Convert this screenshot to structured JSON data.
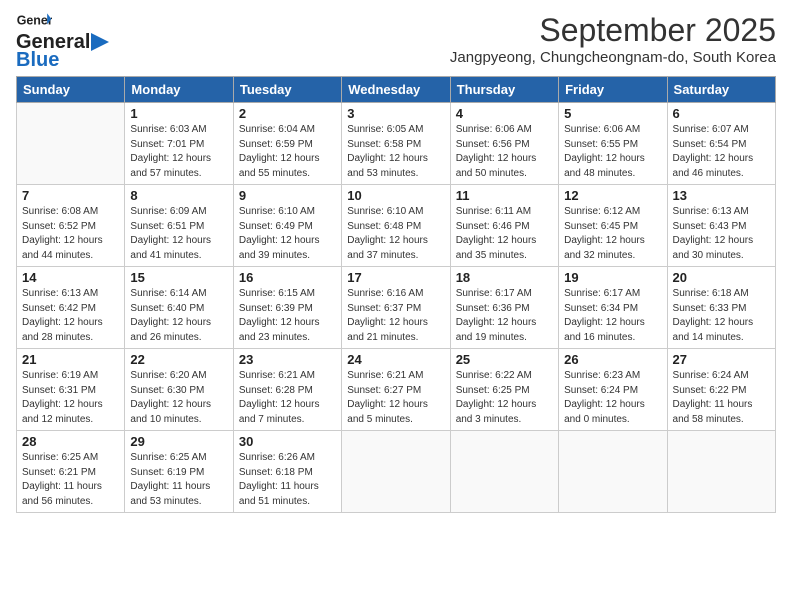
{
  "header": {
    "logo_line1": "General",
    "logo_line2": "Blue",
    "month_title": "September 2025",
    "location": "Jangpyeong, Chungcheongnam-do, South Korea"
  },
  "weekdays": [
    "Sunday",
    "Monday",
    "Tuesday",
    "Wednesday",
    "Thursday",
    "Friday",
    "Saturday"
  ],
  "weeks": [
    [
      {
        "day": "",
        "detail": ""
      },
      {
        "day": "1",
        "detail": "Sunrise: 6:03 AM\nSunset: 7:01 PM\nDaylight: 12 hours\nand 57 minutes."
      },
      {
        "day": "2",
        "detail": "Sunrise: 6:04 AM\nSunset: 6:59 PM\nDaylight: 12 hours\nand 55 minutes."
      },
      {
        "day": "3",
        "detail": "Sunrise: 6:05 AM\nSunset: 6:58 PM\nDaylight: 12 hours\nand 53 minutes."
      },
      {
        "day": "4",
        "detail": "Sunrise: 6:06 AM\nSunset: 6:56 PM\nDaylight: 12 hours\nand 50 minutes."
      },
      {
        "day": "5",
        "detail": "Sunrise: 6:06 AM\nSunset: 6:55 PM\nDaylight: 12 hours\nand 48 minutes."
      },
      {
        "day": "6",
        "detail": "Sunrise: 6:07 AM\nSunset: 6:54 PM\nDaylight: 12 hours\nand 46 minutes."
      }
    ],
    [
      {
        "day": "7",
        "detail": "Sunrise: 6:08 AM\nSunset: 6:52 PM\nDaylight: 12 hours\nand 44 minutes."
      },
      {
        "day": "8",
        "detail": "Sunrise: 6:09 AM\nSunset: 6:51 PM\nDaylight: 12 hours\nand 41 minutes."
      },
      {
        "day": "9",
        "detail": "Sunrise: 6:10 AM\nSunset: 6:49 PM\nDaylight: 12 hours\nand 39 minutes."
      },
      {
        "day": "10",
        "detail": "Sunrise: 6:10 AM\nSunset: 6:48 PM\nDaylight: 12 hours\nand 37 minutes."
      },
      {
        "day": "11",
        "detail": "Sunrise: 6:11 AM\nSunset: 6:46 PM\nDaylight: 12 hours\nand 35 minutes."
      },
      {
        "day": "12",
        "detail": "Sunrise: 6:12 AM\nSunset: 6:45 PM\nDaylight: 12 hours\nand 32 minutes."
      },
      {
        "day": "13",
        "detail": "Sunrise: 6:13 AM\nSunset: 6:43 PM\nDaylight: 12 hours\nand 30 minutes."
      }
    ],
    [
      {
        "day": "14",
        "detail": "Sunrise: 6:13 AM\nSunset: 6:42 PM\nDaylight: 12 hours\nand 28 minutes."
      },
      {
        "day": "15",
        "detail": "Sunrise: 6:14 AM\nSunset: 6:40 PM\nDaylight: 12 hours\nand 26 minutes."
      },
      {
        "day": "16",
        "detail": "Sunrise: 6:15 AM\nSunset: 6:39 PM\nDaylight: 12 hours\nand 23 minutes."
      },
      {
        "day": "17",
        "detail": "Sunrise: 6:16 AM\nSunset: 6:37 PM\nDaylight: 12 hours\nand 21 minutes."
      },
      {
        "day": "18",
        "detail": "Sunrise: 6:17 AM\nSunset: 6:36 PM\nDaylight: 12 hours\nand 19 minutes."
      },
      {
        "day": "19",
        "detail": "Sunrise: 6:17 AM\nSunset: 6:34 PM\nDaylight: 12 hours\nand 16 minutes."
      },
      {
        "day": "20",
        "detail": "Sunrise: 6:18 AM\nSunset: 6:33 PM\nDaylight: 12 hours\nand 14 minutes."
      }
    ],
    [
      {
        "day": "21",
        "detail": "Sunrise: 6:19 AM\nSunset: 6:31 PM\nDaylight: 12 hours\nand 12 minutes."
      },
      {
        "day": "22",
        "detail": "Sunrise: 6:20 AM\nSunset: 6:30 PM\nDaylight: 12 hours\nand 10 minutes."
      },
      {
        "day": "23",
        "detail": "Sunrise: 6:21 AM\nSunset: 6:28 PM\nDaylight: 12 hours\nand 7 minutes."
      },
      {
        "day": "24",
        "detail": "Sunrise: 6:21 AM\nSunset: 6:27 PM\nDaylight: 12 hours\nand 5 minutes."
      },
      {
        "day": "25",
        "detail": "Sunrise: 6:22 AM\nSunset: 6:25 PM\nDaylight: 12 hours\nand 3 minutes."
      },
      {
        "day": "26",
        "detail": "Sunrise: 6:23 AM\nSunset: 6:24 PM\nDaylight: 12 hours\nand 0 minutes."
      },
      {
        "day": "27",
        "detail": "Sunrise: 6:24 AM\nSunset: 6:22 PM\nDaylight: 11 hours\nand 58 minutes."
      }
    ],
    [
      {
        "day": "28",
        "detail": "Sunrise: 6:25 AM\nSunset: 6:21 PM\nDaylight: 11 hours\nand 56 minutes."
      },
      {
        "day": "29",
        "detail": "Sunrise: 6:25 AM\nSunset: 6:19 PM\nDaylight: 11 hours\nand 53 minutes."
      },
      {
        "day": "30",
        "detail": "Sunrise: 6:26 AM\nSunset: 6:18 PM\nDaylight: 11 hours\nand 51 minutes."
      },
      {
        "day": "",
        "detail": ""
      },
      {
        "day": "",
        "detail": ""
      },
      {
        "day": "",
        "detail": ""
      },
      {
        "day": "",
        "detail": ""
      }
    ]
  ]
}
